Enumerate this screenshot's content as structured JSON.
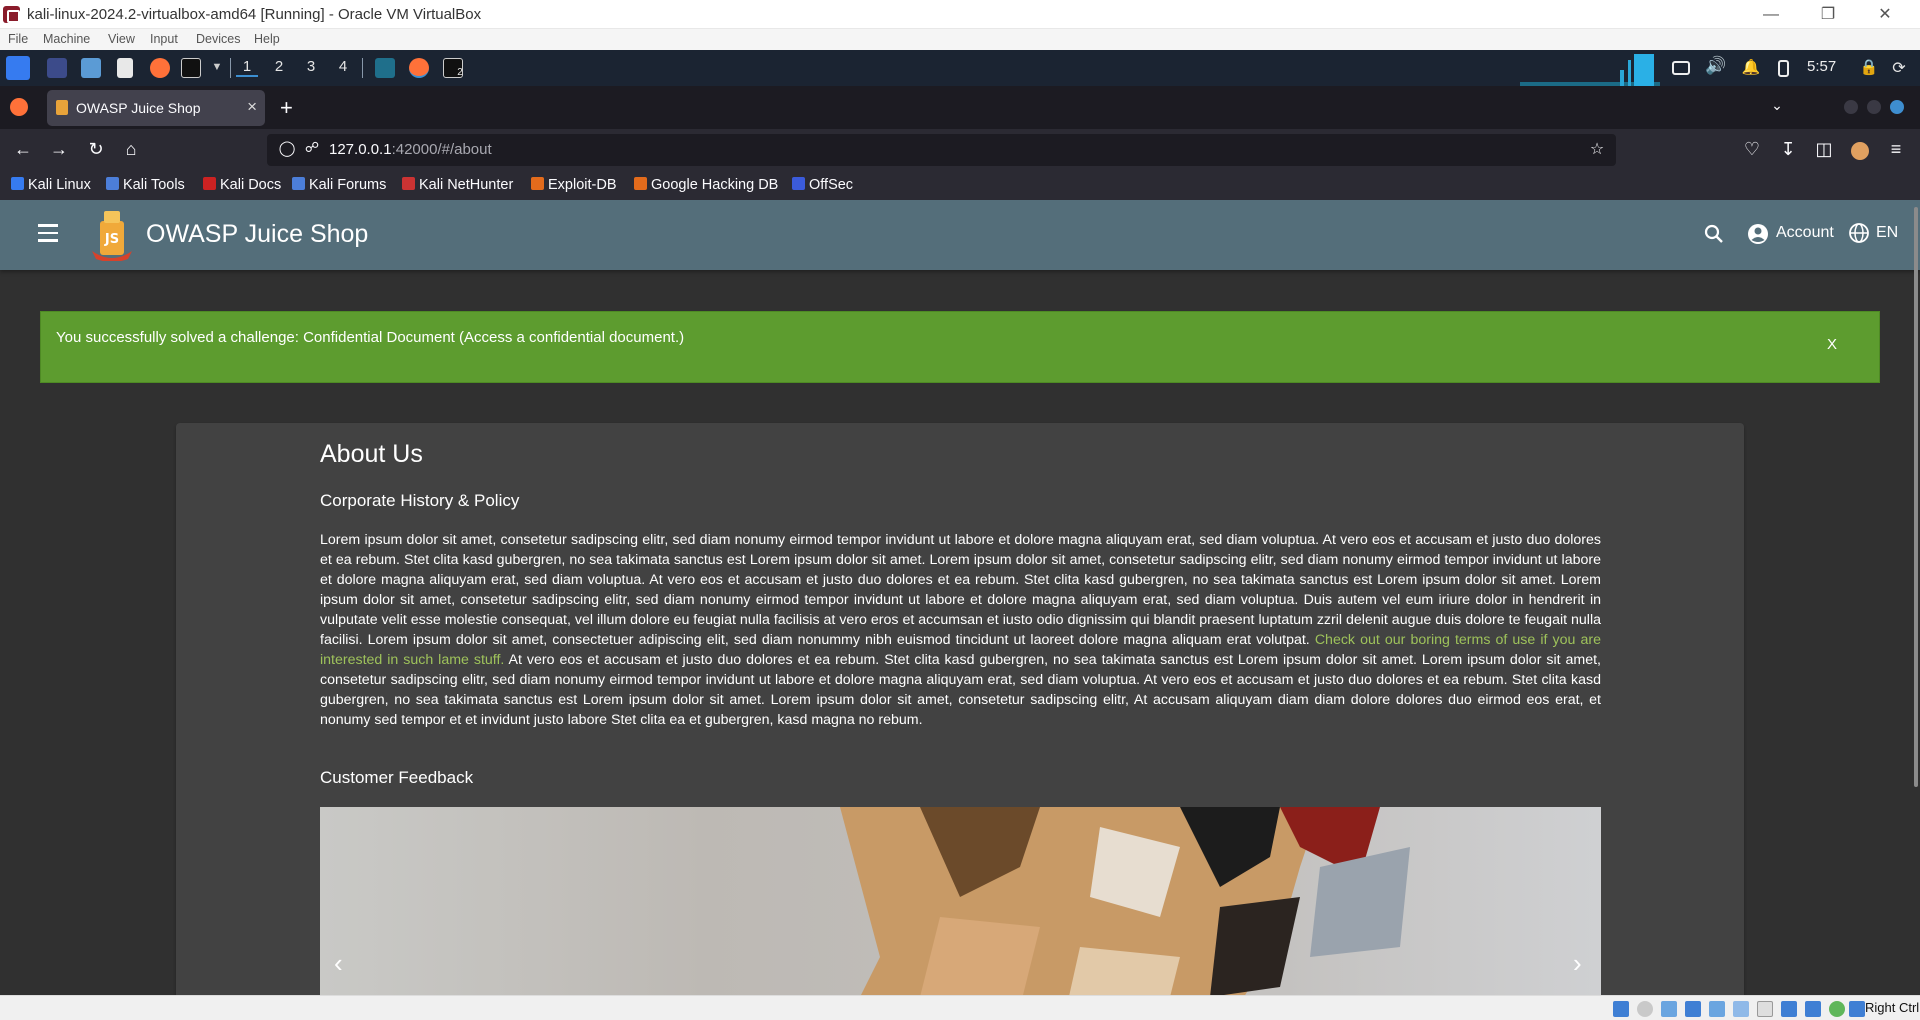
{
  "window": {
    "title": "kali-linux-2024.2-virtualbox-amd64 [Running] - Oracle VM VirtualBox",
    "menu": [
      "File",
      "Machine",
      "View",
      "Input",
      "Devices",
      "Help"
    ]
  },
  "panel": {
    "workspaces": [
      "1",
      "2",
      "3",
      "4"
    ],
    "terminal_badge": "2",
    "clock": "5:57"
  },
  "browser": {
    "tab_title": "OWASP Juice Shop",
    "url_host": "127.0.0.1",
    "url_rest": ":42000/#/about",
    "bookmarks": [
      "Kali Linux",
      "Kali Tools",
      "Kali Docs",
      "Kali Forums",
      "Kali NetHunter",
      "Exploit-DB",
      "Google Hacking DB",
      "OffSec"
    ]
  },
  "app": {
    "title": "OWASP Juice Shop",
    "account_label": "Account",
    "language_label": "EN"
  },
  "notification": {
    "text": "You successfully solved a challenge: Confidential Document (Access a confidential document.)",
    "close_label": "X"
  },
  "about": {
    "heading": "About Us",
    "subheading": "Corporate History & Policy",
    "body_before_link": "Lorem ipsum dolor sit amet, consetetur sadipscing elitr, sed diam nonumy eirmod tempor invidunt ut labore et dolore magna aliquyam erat, sed diam voluptua. At vero eos et accusam et justo duo dolores et ea rebum. Stet clita kasd gubergren, no sea takimata sanctus est Lorem ipsum dolor sit amet. Lorem ipsum dolor sit amet, consetetur sadipscing elitr, sed diam nonumy eirmod tempor invidunt ut labore et dolore magna aliquyam erat, sed diam voluptua. At vero eos et accusam et justo duo dolores et ea rebum. Stet clita kasd gubergren, no sea takimata sanctus est Lorem ipsum dolor sit amet. Lorem ipsum dolor sit amet, consetetur sadipscing elitr, sed diam nonumy eirmod tempor invidunt ut labore et dolore magna aliquyam erat, sed diam voluptua. Duis autem vel eum iriure dolor in hendrerit in vulputate velit esse molestie consequat, vel illum dolore eu feugiat nulla facilisis at vero eros et accumsan et iusto odio dignissim qui blandit praesent luptatum zzril delenit augue duis dolore te feugait nulla facilisi. Lorem ipsum dolor sit amet, consectetuer adipiscing elit, sed diam nonummy nibh euismod tincidunt ut laoreet dolore magna aliquam erat volutpat. ",
    "link_text": "Check out our boring terms of use if you are interested in such lame stuff.",
    "body_after_link": " At vero eos et accusam et justo duo dolores et ea rebum. Stet clita kasd gubergren, no sea takimata sanctus est Lorem ipsum dolor sit amet. Lorem ipsum dolor sit amet, consetetur sadipscing elitr, sed diam nonumy eirmod tempor invidunt ut labore et dolore magna aliquyam erat, sed diam voluptua. At vero eos et accusam et justo duo dolores et ea rebum. Stet clita kasd gubergren, no sea takimata sanctus est Lorem ipsum dolor sit amet. Lorem ipsum dolor sit amet, consetetur sadipscing elitr, At accusam aliquyam diam diam dolore dolores duo eirmod eos erat, et nonumy sed tempor et et invidunt justo labore Stet clita ea et gubergren, kasd magna no rebum.",
    "feedback_heading": "Customer Feedback",
    "prev_label": "‹",
    "next_label": "›"
  },
  "statusbar": {
    "host_key": "Right Ctrl"
  },
  "colors": {
    "appbar": "#546e7a",
    "page_bg": "#303030",
    "card_bg": "#424242",
    "success": "#5d9c2f",
    "link": "#9ec25b"
  }
}
